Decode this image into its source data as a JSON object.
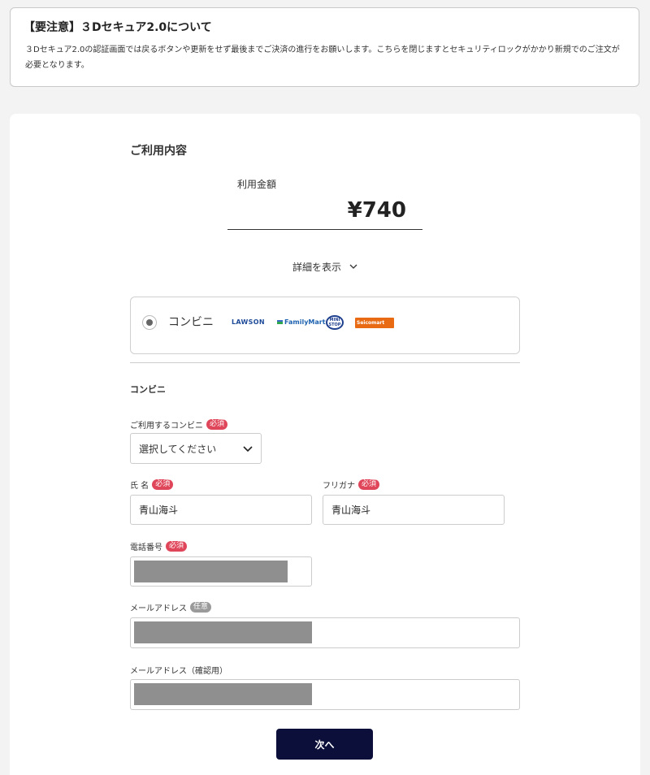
{
  "notice": {
    "title": "【要注意】３Dセキュア2.0について",
    "text": "３Dセキュア2.0の認証画面では戻るボタンや更新をせず最後までご決済の進行をお願いします。こちらを閉じますとセキュリティロックがかかり新規でのご注文が必要となります。"
  },
  "usage": {
    "title": "ご利用内容",
    "amount_label": "利用金額",
    "amount_value": "¥740",
    "details_toggle": "詳細を表示"
  },
  "payment_method": {
    "label": "コンビニ",
    "selected": true,
    "logos": [
      "LAWSON",
      "FamilyMart",
      "MINI STOP",
      "Seicomart"
    ]
  },
  "form": {
    "section_title": "コンビニ",
    "required_badge": "必須",
    "optional_badge": "任意",
    "store": {
      "label": "ご利用するコンビニ",
      "value": "選択してください"
    },
    "name": {
      "label": "氏 名",
      "value": "青山海斗"
    },
    "furigana": {
      "label": "フリガナ",
      "value": "青山海斗"
    },
    "phone": {
      "label": "電話番号"
    },
    "email": {
      "label": "メールアドレス"
    },
    "email_confirm": {
      "label": "メールアドレス（確認用）"
    }
  },
  "next_button": "次へ",
  "colors": {
    "primary_button": "#0b0f3a",
    "required": "#e0465a",
    "optional": "#9a9a9a"
  }
}
